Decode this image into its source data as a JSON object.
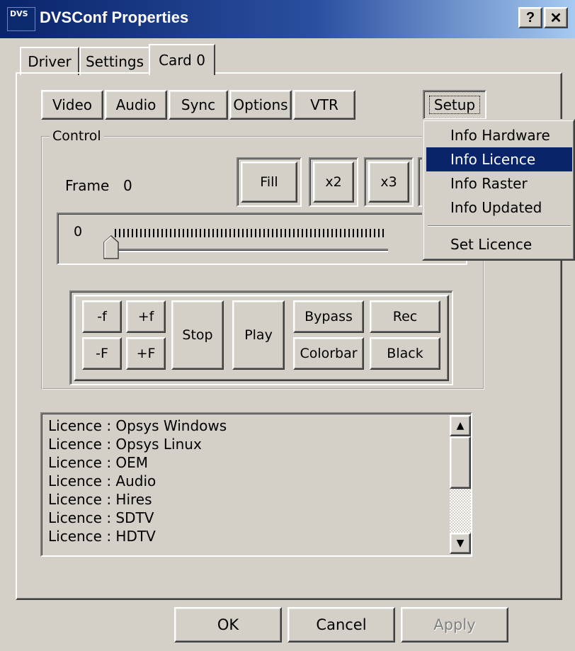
{
  "window": {
    "title": "DVSConf Properties",
    "help_label": "?",
    "close_label": "✕",
    "icon_label": "DVS"
  },
  "tabs": [
    "Driver",
    "Settings",
    "Card 0"
  ],
  "subtabs": [
    "Video",
    "Audio",
    "Sync",
    "Options",
    "VTR",
    "Setup"
  ],
  "control": {
    "legend": "Control",
    "frame_label": "Frame",
    "frame_value": "0",
    "buttons": [
      "Fill",
      "x2",
      "x3"
    ],
    "slider_value": "0"
  },
  "transport": {
    "minus_f": "-f",
    "plus_f": "+f",
    "minus_F": "-F",
    "plus_F": "+F",
    "stop": "Stop",
    "play": "Play",
    "bypass": "Bypass",
    "rec": "Rec",
    "colorbar": "Colorbar",
    "black": "Black"
  },
  "licence_list": [
    "Licence : Opsys Windows",
    "Licence : Opsys Linux",
    "Licence : OEM",
    "Licence : Audio",
    "Licence : Hires",
    "Licence : SDTV",
    "Licence : HDTV"
  ],
  "footer": {
    "ok": "OK",
    "cancel": "Cancel",
    "apply": "Apply"
  },
  "setup_menu": {
    "items": [
      "Info Hardware",
      "Info Licence",
      "Info Raster",
      "Info Updated",
      "Set Licence"
    ],
    "selected": "Info Licence"
  },
  "colors": {
    "face": "#d4d0c8",
    "title_start": "#0a246a",
    "title_end": "#a6caf0",
    "highlight": "#0a246a"
  }
}
